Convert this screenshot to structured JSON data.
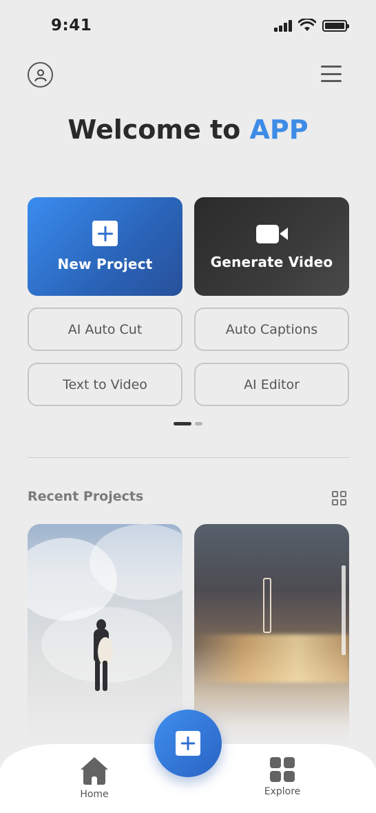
{
  "status_bar": {
    "time": "9:41"
  },
  "header": {
    "title_prefix": "Welcome to ",
    "title_accent": "APP"
  },
  "primary_actions": [
    {
      "label": "New Project",
      "icon": "plus-square-icon"
    },
    {
      "label": "Generate Video",
      "icon": "video-camera-icon"
    }
  ],
  "tools": [
    {
      "label": "AI Auto Cut"
    },
    {
      "label": "Auto Captions"
    },
    {
      "label": "Text to Video"
    },
    {
      "label": "AI Editor"
    }
  ],
  "pager": {
    "current": 1,
    "total": 2
  },
  "recent": {
    "title": "Recent Projects",
    "view_toggle_icon": "grid-view-icon",
    "items": [
      {
        "thumbnail": "surfer-in-wave"
      },
      {
        "thumbnail": "city-street-night"
      }
    ]
  },
  "bottom_nav": {
    "items": [
      {
        "label": "Home",
        "icon": "home-icon"
      },
      {
        "label": "Explore",
        "icon": "explore-grid-icon"
      }
    ],
    "fab_icon": "plus-square-icon"
  },
  "colors": {
    "accent": "#3d8be6",
    "background": "#ececec",
    "dark_card": "#2b2b2b"
  }
}
